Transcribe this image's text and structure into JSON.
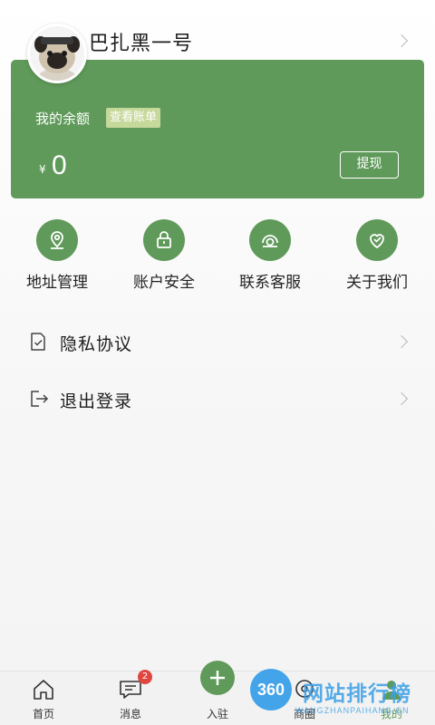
{
  "profile": {
    "username": "巴扎黑一号"
  },
  "balance": {
    "label": "我的余额",
    "view_bill_label": "查看账单",
    "currency_symbol": "¥",
    "amount": "0",
    "withdraw_label": "提现"
  },
  "grid": [
    {
      "label": "地址管理",
      "icon": "location-icon"
    },
    {
      "label": "账户安全",
      "icon": "lock-icon"
    },
    {
      "label": "联系客服",
      "icon": "headset-icon"
    },
    {
      "label": "关于我们",
      "icon": "heart-icon"
    }
  ],
  "list": [
    {
      "label": "隐私协议",
      "icon": "document-check-icon"
    },
    {
      "label": "退出登录",
      "icon": "logout-icon"
    }
  ],
  "tabbar": {
    "items": [
      {
        "label": "首页",
        "icon": "home-icon"
      },
      {
        "label": "消息",
        "icon": "message-icon",
        "badge": "2"
      },
      {
        "label": "入驻",
        "icon": "plus-icon"
      },
      {
        "label": "商圈",
        "icon": "circle-icon"
      },
      {
        "label": "我的",
        "icon": "user-icon"
      }
    ]
  },
  "watermark": {
    "circle_text": "360",
    "text": "网站排行榜",
    "sub": "WANGZHANPAIHANG.CN"
  },
  "colors": {
    "accent": "#5f9a5a",
    "badge": "#e0463f",
    "bill_tag": "#c7d89b"
  }
}
